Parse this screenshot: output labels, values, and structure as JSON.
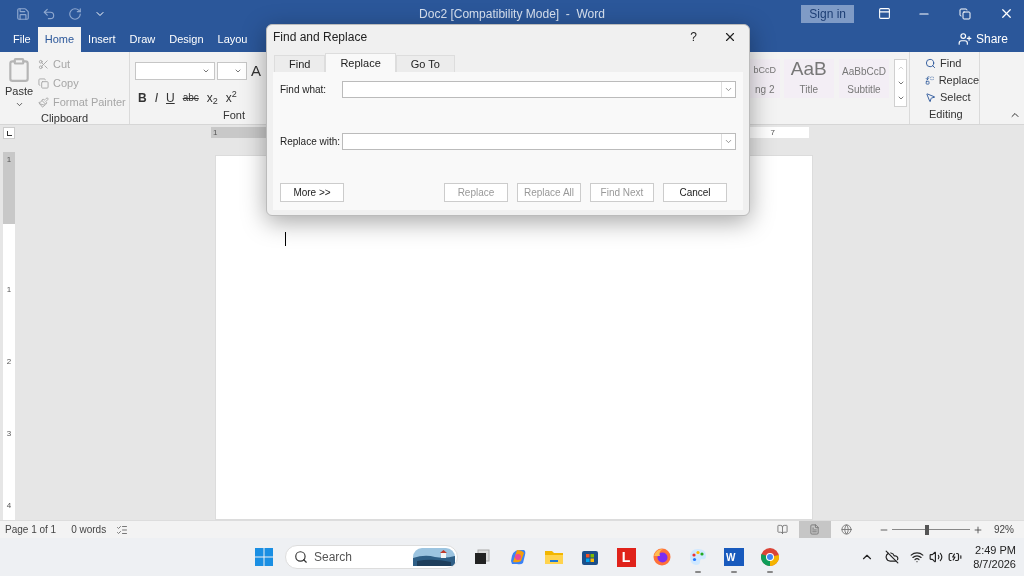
{
  "title_bar": {
    "title": "Doc2 [Compatibility Mode]  -  Word",
    "sign_in": "Sign in"
  },
  "ribbon_tabs": [
    {
      "label": "File",
      "selected": false
    },
    {
      "label": "Home",
      "selected": true
    },
    {
      "label": "Insert",
      "selected": false
    },
    {
      "label": "Draw",
      "selected": false
    },
    {
      "label": "Design",
      "selected": false
    },
    {
      "label": "Layou",
      "selected": false
    }
  ],
  "share": "Share",
  "clipboard": {
    "paste": "Paste",
    "label": "Clipboard",
    "items": [
      {
        "kind": "cut",
        "label": "Cut",
        "disabled": true
      },
      {
        "kind": "copy",
        "label": "Copy",
        "disabled": true
      },
      {
        "kind": "painter",
        "label": "Format Painter",
        "disabled": true
      }
    ]
  },
  "font": {
    "label": "Font",
    "grow": "A",
    "formats": [
      "B",
      "I",
      "U",
      "abc",
      "x$_{2}$",
      "x$^{2}$"
    ]
  },
  "styles": [
    {
      "preview": "bCcD",
      "name": "ng 2"
    },
    {
      "preview": "AaB",
      "name": "Title"
    },
    {
      "preview": "AaBbCcD",
      "name": "Subtitle"
    }
  ],
  "editing": {
    "label": "Editing",
    "items": [
      {
        "kind": "find",
        "label": "Find"
      },
      {
        "kind": "replace",
        "label": "Replace"
      },
      {
        "kind": "select",
        "label": "Select"
      }
    ]
  },
  "ruler": {
    "start": "1",
    "end": "7",
    "vertical": [
      "1",
      "1",
      "2",
      "3",
      "4"
    ]
  },
  "dialog": {
    "title": "Find and Replace",
    "help": "?",
    "tabs": [
      {
        "label": "Find",
        "selected": false
      },
      {
        "label": "Replace",
        "selected": true
      },
      {
        "label": "Go To",
        "selected": false
      }
    ],
    "fields": [
      {
        "label": "Find what:"
      },
      {
        "label": "Replace with:"
      }
    ],
    "buttons": [
      {
        "label": "More >>",
        "disabled": false
      },
      {
        "label": "Replace",
        "disabled": true
      },
      {
        "label": "Replace All",
        "disabled": true
      },
      {
        "label": "Find Next",
        "disabled": true
      },
      {
        "label": "Cancel",
        "disabled": false
      }
    ]
  },
  "status_bar": {
    "page": "Page 1 of 1",
    "words": "0 words",
    "views": [
      {
        "kind": "read",
        "selected": false
      },
      {
        "kind": "print",
        "selected": true
      },
      {
        "kind": "web",
        "selected": false
      }
    ],
    "zoom": {
      "level": 0.45
    },
    "zoom_reading": "92%"
  },
  "taskbar": {
    "search_placeholder": "Search",
    "apps": [
      {
        "kind": "taskview",
        "running": false
      },
      {
        "kind": "copilot",
        "running": false
      },
      {
        "kind": "folder",
        "running": false
      },
      {
        "kind": "store",
        "running": false
      },
      {
        "kind": "letter",
        "letter": "L",
        "running": false
      },
      {
        "kind": "firefox",
        "running": false
      },
      {
        "kind": "paint",
        "running": true
      },
      {
        "kind": "word",
        "letter": "W",
        "running": true
      },
      {
        "kind": "chrome",
        "running": true
      }
    ],
    "time": "2:49 PM",
    "date": "8/7/2026"
  }
}
